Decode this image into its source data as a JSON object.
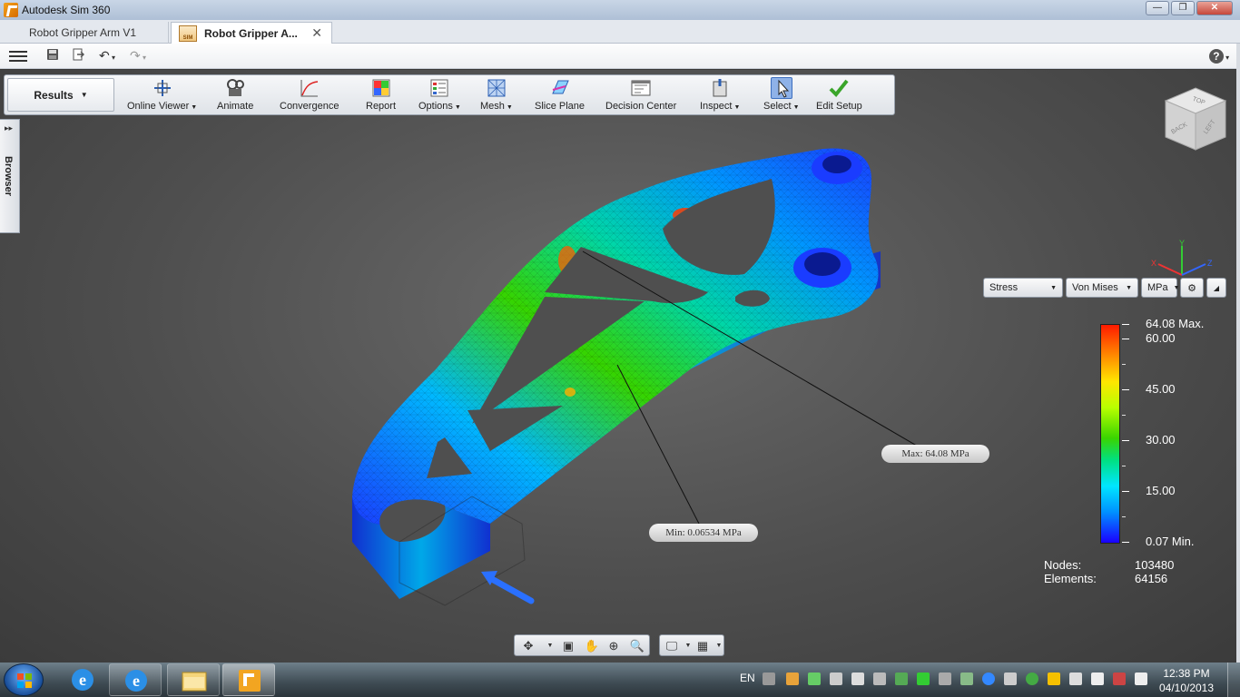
{
  "window": {
    "title": "Autodesk Sim 360",
    "controls": {
      "minimize": "—",
      "restore": "❐",
      "close": "✕"
    }
  },
  "doc_tabs": [
    {
      "label": "Robot Gripper Arm V1",
      "active": false
    },
    {
      "label": "Robot Gripper A...",
      "active": true,
      "icon_text": "SIM"
    }
  ],
  "quick_access": {
    "icons": [
      "menu-icon",
      "save-icon",
      "export-icon",
      "undo-icon",
      "redo-icon",
      "help-icon"
    ],
    "undo_glyph": "↶",
    "redo_glyph": "↷",
    "help_glyph": "?"
  },
  "ribbon": {
    "active_tab": "Results",
    "buttons": [
      {
        "name": "online-viewer",
        "label": "Online Viewer",
        "dropdown": true
      },
      {
        "name": "animate",
        "label": "Animate",
        "dropdown": false
      },
      {
        "name": "convergence",
        "label": "Convergence",
        "dropdown": false
      },
      {
        "name": "report",
        "label": "Report",
        "dropdown": false
      },
      {
        "name": "options",
        "label": "Options",
        "dropdown": true
      },
      {
        "name": "mesh",
        "label": "Mesh",
        "dropdown": true
      },
      {
        "name": "slice-plane",
        "label": "Slice Plane",
        "dropdown": false
      },
      {
        "name": "decision-center",
        "label": "Decision Center",
        "dropdown": false
      },
      {
        "name": "inspect",
        "label": "Inspect",
        "dropdown": true
      },
      {
        "name": "select",
        "label": "Select",
        "dropdown": true,
        "selected": true
      },
      {
        "name": "edit-setup",
        "label": "Edit Setup",
        "dropdown": false
      }
    ]
  },
  "browser_panel": {
    "label": "Browser",
    "arrows": "▸▸"
  },
  "view_cube": {
    "faces": [
      "TOP",
      "BACK",
      "LEFT"
    ]
  },
  "axis_triad": {
    "x": "X",
    "y": "Y",
    "z": "Z"
  },
  "results": {
    "result_type": "Stress",
    "component": "Von Mises",
    "unit": "MPa",
    "legend": {
      "max_label": "64.08 Max.",
      "min_label": "0.07 Min.",
      "ticks": [
        "60.00",
        "45.00",
        "30.00",
        "15.00"
      ]
    },
    "max_callout": "Max: 64.08 MPa",
    "min_callout": "Min: 0.06534 MPa",
    "stats": {
      "nodes_label": "Nodes:",
      "nodes_value": "103480",
      "elements_label": "Elements:",
      "elements_value": "64156"
    }
  },
  "navigation_bar": {
    "icons": [
      "orbit-icon",
      "look-at-icon",
      "pan-icon",
      "zoom-icon",
      "zoom-window-icon",
      "display-settings-icon",
      "grid-icon"
    ]
  },
  "taskbar": {
    "language": "EN",
    "time": "12:38 PM",
    "date": "04/10/2013",
    "pinned": [
      "internet-explorer",
      "internet-explorer",
      "file-explorer",
      "autodesk-sim-360"
    ]
  }
}
